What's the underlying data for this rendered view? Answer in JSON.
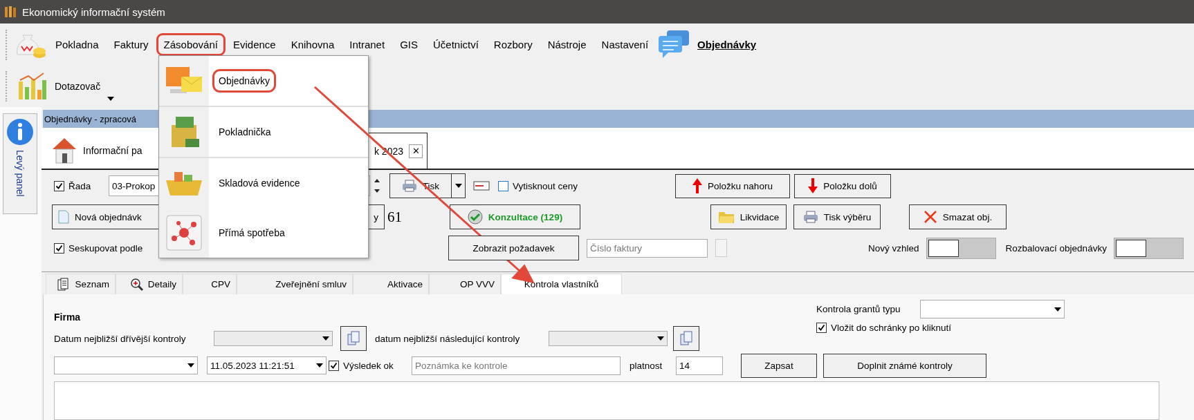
{
  "window": {
    "title": "Ekonomický informační systém"
  },
  "menu": {
    "items": [
      {
        "label": "Pokladna",
        "highlighted": false
      },
      {
        "label": "Faktury",
        "highlighted": false
      },
      {
        "label": "Zásobování",
        "highlighted": true
      },
      {
        "label": "Evidence",
        "highlighted": false
      },
      {
        "label": "Knihovna",
        "highlighted": false
      },
      {
        "label": "Intranet",
        "highlighted": false
      },
      {
        "label": "GIS",
        "highlighted": false
      },
      {
        "label": "Účetnictví",
        "highlighted": false
      },
      {
        "label": "Rozbory",
        "highlighted": false
      },
      {
        "label": "Nástroje",
        "highlighted": false
      },
      {
        "label": "Nastavení",
        "highlighted": false
      }
    ],
    "shortcut": "Objednávky"
  },
  "toolbar": {
    "button": "Dotazovač"
  },
  "dropdown": {
    "items": [
      {
        "label": "Objednávky",
        "highlighted": true
      },
      {
        "label": "Pokladnička",
        "highlighted": false
      },
      {
        "label": "Skladová evidence",
        "highlighted": false
      },
      {
        "label": "Přímá spotřeba",
        "highlighted": false
      }
    ]
  },
  "left_panel": "Levý panel",
  "header": "Objednávky - zpracová",
  "document_tabs": [
    {
      "label": "Informační pa",
      "selected": false
    },
    {
      "label": "k 2023",
      "selected": true,
      "close": "✕"
    }
  ],
  "form": {
    "series": {
      "label": "Řada",
      "checked": true,
      "value": "03-Prokop"
    },
    "print": "Tisk",
    "print_prices": {
      "label": "Vytisknout ceny",
      "checked": false
    },
    "move_up": "Položku nahoru",
    "move_down": "Položku dolů",
    "new_order": "Nová objednávk",
    "partial_button": "y",
    "count": "61",
    "consult": "Konzultace (129)",
    "liquidation": "Likvidace",
    "print_selection": "Tisk výběru",
    "delete": "Smazat obj.",
    "group_by": {
      "label": "Seskupovat podle",
      "checked": true
    },
    "show_request": "Zobrazit požadavek",
    "invoice": {
      "placeholder": "Číslo faktury"
    },
    "new_look": {
      "label": "Nový vzhled",
      "on": false
    },
    "expand_orders": {
      "label": "Rozbalovací objednávky",
      "on": false
    }
  },
  "detail_tabs": [
    {
      "label": "Seznam",
      "selected": false
    },
    {
      "label": "Detaily",
      "selected": false
    },
    {
      "label": "CPV",
      "selected": false
    },
    {
      "label": "Zveřejnění smluv",
      "selected": false
    },
    {
      "label": "Aktivace",
      "selected": false
    },
    {
      "label": "OP VVV",
      "selected": false
    },
    {
      "label": "Kontrola vlastníků",
      "selected": true
    }
  ],
  "owner_check": {
    "section": "Firma",
    "previous": {
      "label": "Datum nejbližší dřívější kontroly",
      "disabled": true
    },
    "next": {
      "label": "datum nejbližší následující kontroly",
      "disabled": true
    },
    "grant_label": "Kontrola grantů typu",
    "clipboard": {
      "label": "Vložit do schránky po kliknutí",
      "checked": true
    },
    "date": "11.05.2023 11:21:51",
    "result": {
      "label": "Výsledek ok",
      "checked": true
    },
    "note": {
      "placeholder": "Poznámka ke kontrole"
    },
    "validity_label": "platnost",
    "validity": "14",
    "save": "Zapsat",
    "fill": "Doplnit známé kontroly"
  }
}
